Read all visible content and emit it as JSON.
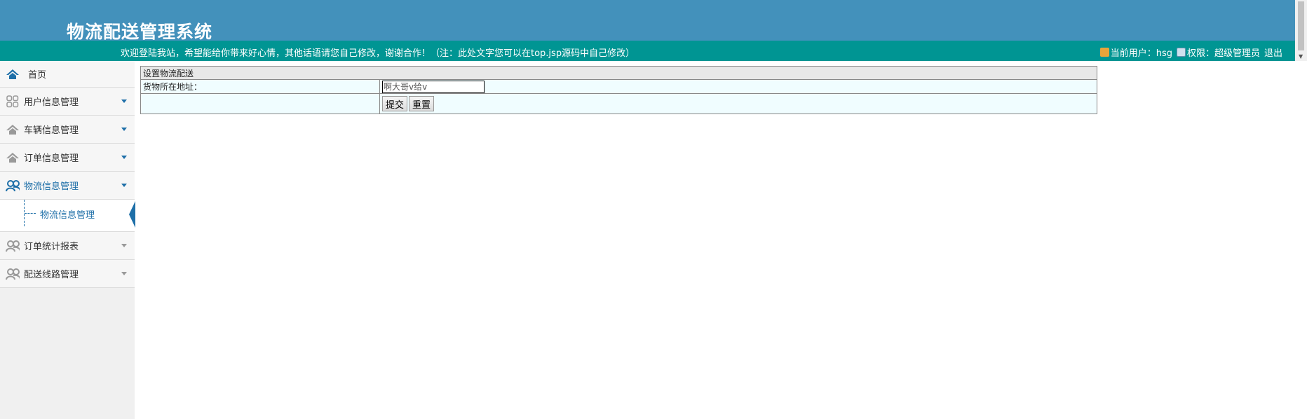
{
  "header": {
    "title": "物流配送管理系统",
    "welcome": "欢迎登陆我站，希望能给你带来好心情，其他话语请您自己修改，谢谢合作！（注：此处文字您可以在top.jsp源码中自己修改）",
    "user_label": "当前用户：hsg",
    "role_label": "权限：超级管理员",
    "logout": "退出"
  },
  "sidebar": {
    "items": [
      {
        "label": "首页"
      },
      {
        "label": "用户信息管理"
      },
      {
        "label": "车辆信息管理"
      },
      {
        "label": "订单信息管理"
      },
      {
        "label": "物流信息管理"
      },
      {
        "label": "订单统计报表"
      },
      {
        "label": "配送线路管理"
      }
    ],
    "sub_item": "物流信息管理"
  },
  "form": {
    "title": "设置物流配送",
    "address_label": "货物所在地址：",
    "address_value": "啊大哥v给v",
    "submit": "提交",
    "reset": "重置"
  },
  "colors": {
    "header": "#4391bb",
    "bar": "#009593",
    "accent": "#1e6fa8"
  }
}
